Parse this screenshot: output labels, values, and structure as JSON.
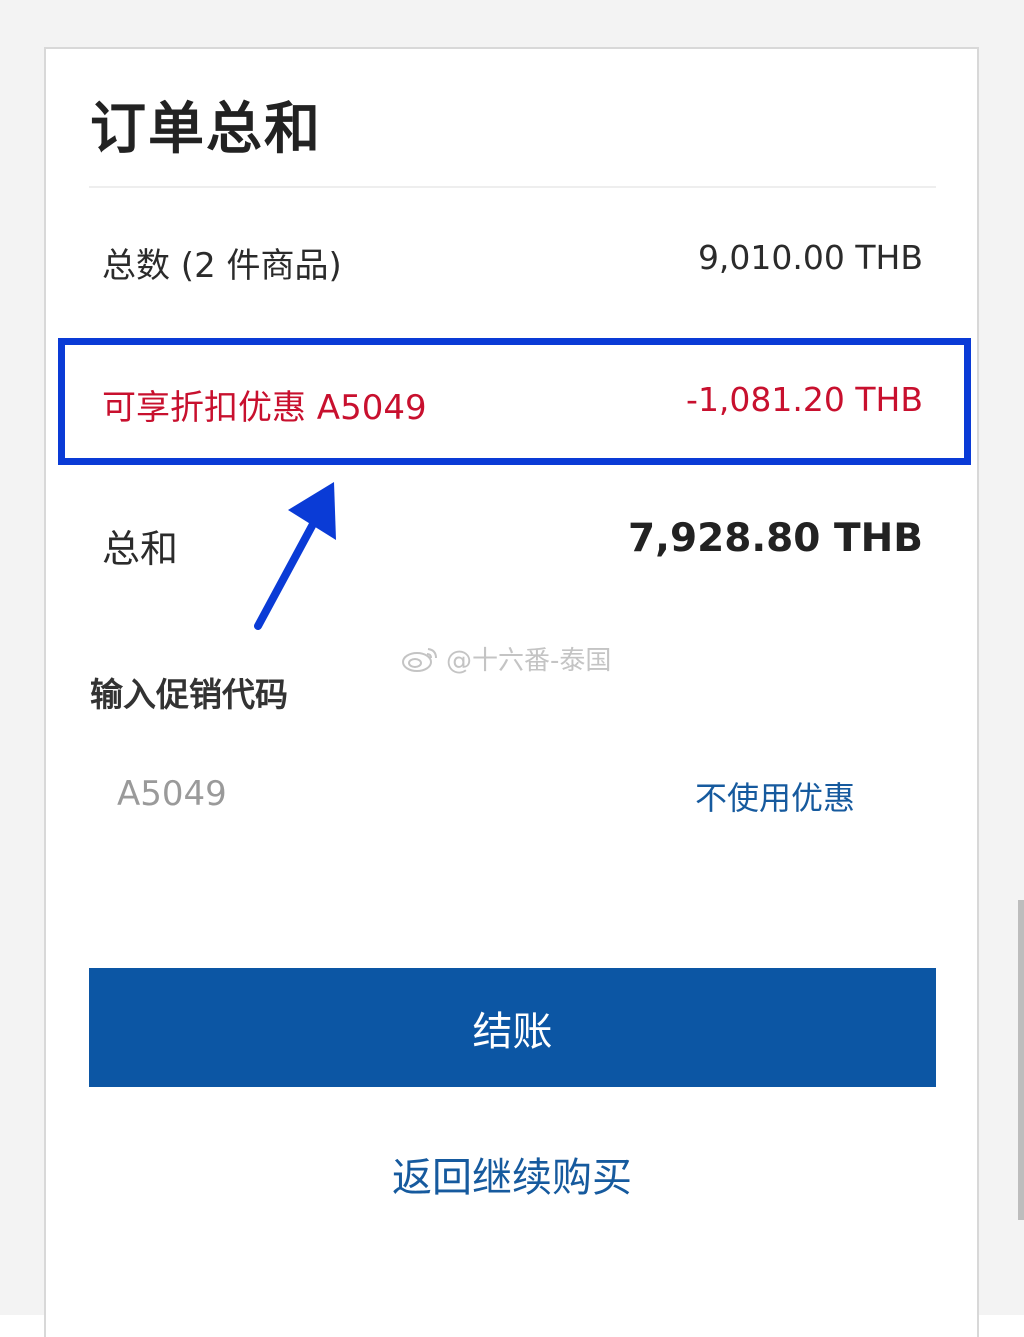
{
  "order_summary": {
    "title": "订单总和",
    "subtotal": {
      "label": "总数 (2 件商品)",
      "value": "9,010.00 THB"
    },
    "discount": {
      "label": "可享折扣优惠 A5049",
      "value": "-1,081.20 THB"
    },
    "total": {
      "label": "总和",
      "value": "7,928.80 THB"
    }
  },
  "promo": {
    "title": "输入促销代码",
    "code_value": "A5049",
    "remove_label": "不使用优惠"
  },
  "actions": {
    "checkout_label": "结账",
    "continue_label": "返回继续购买"
  },
  "watermark": {
    "text": "@十六番-泰国"
  },
  "colors": {
    "discount_red": "#c8102e",
    "primary_blue": "#0c56a4",
    "link_blue": "#165a9e",
    "highlight_blue": "#0a3bd6"
  }
}
